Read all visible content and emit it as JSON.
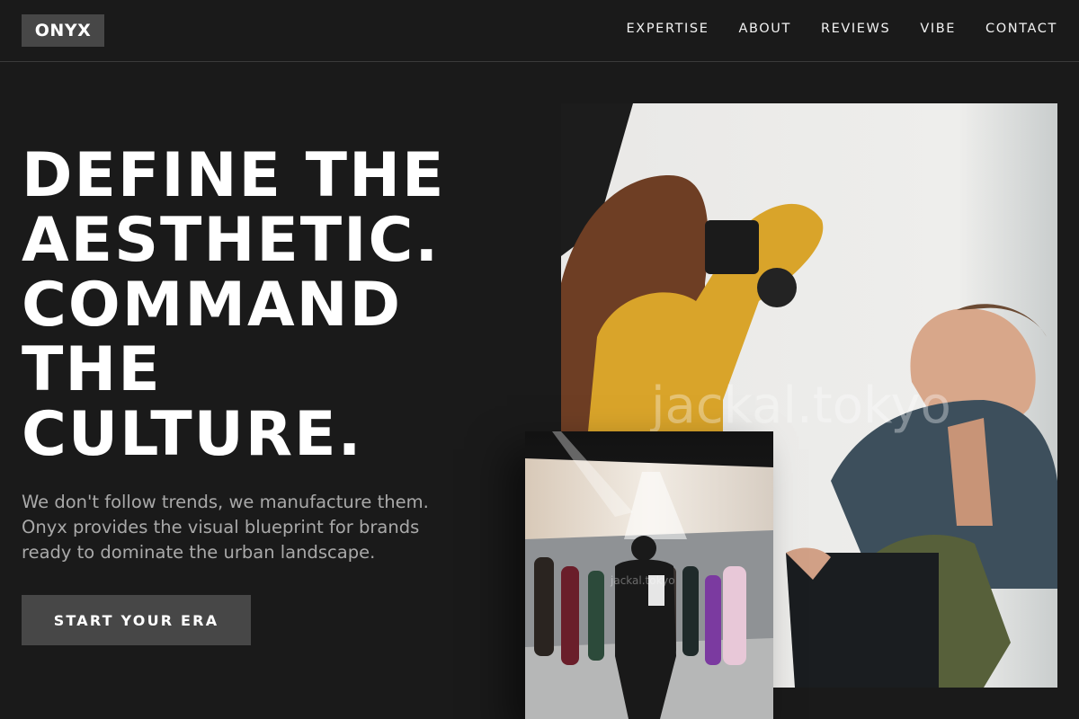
{
  "brand": {
    "logo": "ONYX"
  },
  "nav": {
    "items": [
      {
        "label": "EXPERTISE"
      },
      {
        "label": "ABOUT"
      },
      {
        "label": "REVIEWS"
      },
      {
        "label": "VIBE"
      },
      {
        "label": "CONTACT"
      }
    ]
  },
  "hero": {
    "headline_lines": [
      "DEFINE THE",
      "AESTHETIC.",
      "COMMAND",
      "THE",
      "CULTURE."
    ],
    "tagline": "We don't follow trends, we manufacture them. Onyx provides the visual blueprint for brands ready to dominate the urban landscape.",
    "cta_label": "START YOUR ERA"
  },
  "images": {
    "large_watermark": "jackal.tokyo",
    "small_watermark": "jackal.tokyo"
  },
  "colors": {
    "background": "#1a1a1a",
    "button": "#474747",
    "text_muted": "#a9a9a9"
  }
}
